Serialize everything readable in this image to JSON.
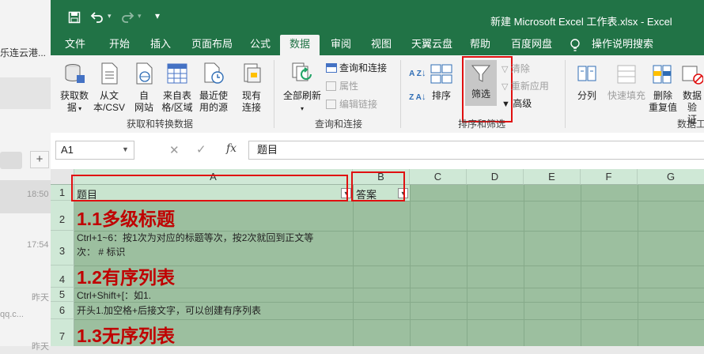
{
  "background_app": {
    "items": [
      {
        "text": "乐连云港..."
      },
      {
        "text": "18:50"
      },
      {
        "text": "17:54"
      },
      {
        "text": "昨天"
      },
      {
        "text": "qq.c..."
      },
      {
        "text": "昨天"
      }
    ],
    "plus": "+"
  },
  "titlebar": {
    "title": "新建 Microsoft Excel 工作表.xlsx  -  Excel"
  },
  "tabs": [
    {
      "label": "文件"
    },
    {
      "label": "开始"
    },
    {
      "label": "插入"
    },
    {
      "label": "页面布局"
    },
    {
      "label": "公式"
    },
    {
      "label": "数据"
    },
    {
      "label": "审阅"
    },
    {
      "label": "视图"
    },
    {
      "label": "天翼云盘"
    },
    {
      "label": "帮助"
    },
    {
      "label": "百度网盘"
    },
    {
      "label": "操作说明搜索"
    }
  ],
  "ribbon": {
    "get_data": {
      "get_data_l1": "获取数",
      "get_data_l2": "据",
      "from_csv_l1": "从文",
      "from_csv_l2": "本/CSV",
      "from_web_l1": "自",
      "from_web_l2": "网站",
      "from_table_l1": "来自表",
      "from_table_l2": "格/区域",
      "recent_l1": "最近使",
      "recent_l2": "用的源",
      "existing_l1": "现有",
      "existing_l2": "连接",
      "group": "获取和转换数据"
    },
    "queries": {
      "refresh_l1": "全部刷新",
      "queries_connections": "查询和连接",
      "properties": "属性",
      "edit_links": "编辑链接",
      "group": "查询和连接"
    },
    "sort_filter": {
      "sort": "排序",
      "filter": "筛选",
      "clear": "清除",
      "reapply": "重新应用",
      "advanced": "高级",
      "group": "排序和筛选"
    },
    "tools": {
      "split": "分列",
      "flash_fill": "快速填充",
      "remove_dup_l1": "删除",
      "remove_dup_l2": "重复值",
      "validate_l1": "数据验",
      "validate_l2": "证",
      "group": "数据工"
    },
    "sort_az": "A Z",
    "sort_za": "Z A"
  },
  "formula_bar": {
    "name_box": "A1",
    "formula": "题目"
  },
  "columns": [
    "A",
    "B",
    "C",
    "D",
    "E",
    "F",
    "G"
  ],
  "rows": [
    {
      "num": "1"
    },
    {
      "num": "2"
    },
    {
      "num": "3"
    },
    {
      "num": "4"
    },
    {
      "num": "5"
    },
    {
      "num": "6"
    },
    {
      "num": "7"
    }
  ],
  "cells": {
    "a1": "题目",
    "b1": "答案",
    "a2": "1.1多级标题",
    "a3_l1": "Ctrl+1~6：按1次为对应的标题等次，按2次就回到正文等",
    "a3_l2": "次：  # 标识",
    "a4": "1.2有序列表",
    "a5": "Ctrl+Shift+[：如1.",
    "a6": "开头1.加空格+后接文字，可以创建有序列表",
    "a7": "1.3无序列表"
  },
  "colors": {
    "excel_green": "#217346",
    "highlight_red": "#e01010",
    "heading_red": "#c00000"
  }
}
